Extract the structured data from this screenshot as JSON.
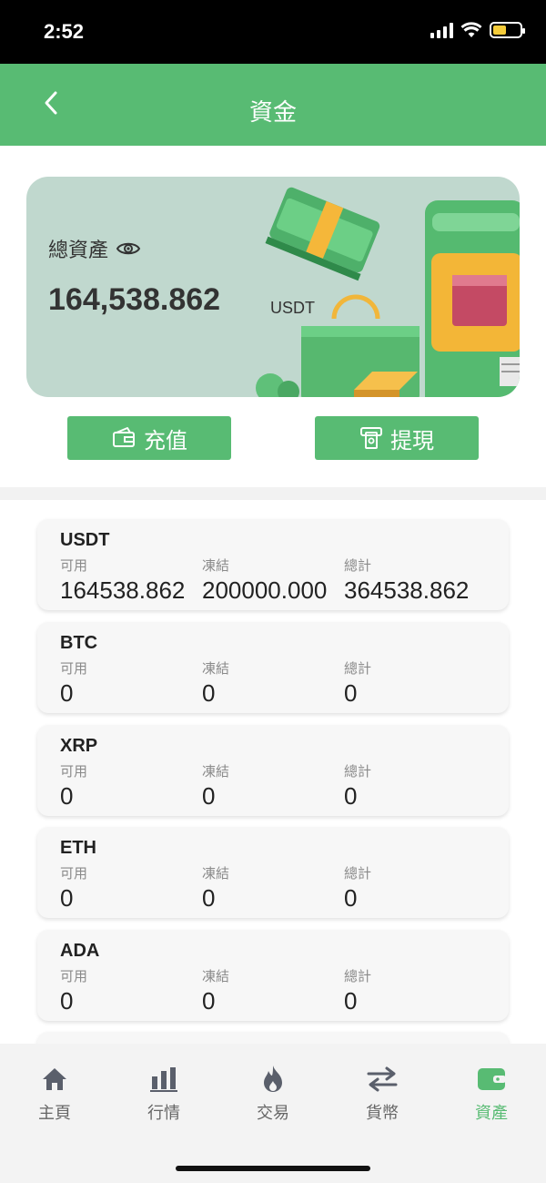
{
  "status_bar": {
    "time": "2:52"
  },
  "header": {
    "title": "資金"
  },
  "balance": {
    "label": "總資產",
    "value": "164,538.862",
    "unit": "USDT"
  },
  "actions": {
    "deposit_label": "充值",
    "withdraw_label": "提現"
  },
  "columns": {
    "available": "可用",
    "frozen": "凍結",
    "total": "總計"
  },
  "assets": [
    {
      "symbol": "USDT",
      "available": "164538.862",
      "frozen": "200000.000",
      "total": "364538.862"
    },
    {
      "symbol": "BTC",
      "available": "0",
      "frozen": "0",
      "total": "0"
    },
    {
      "symbol": "XRP",
      "available": "0",
      "frozen": "0",
      "total": "0"
    },
    {
      "symbol": "ETH",
      "available": "0",
      "frozen": "0",
      "total": "0"
    },
    {
      "symbol": "ADA",
      "available": "0",
      "frozen": "0",
      "total": "0"
    }
  ],
  "tabs": [
    {
      "label": "主頁",
      "icon": "home-icon"
    },
    {
      "label": "行情",
      "icon": "bar-chart-icon"
    },
    {
      "label": "交易",
      "icon": "flame-icon"
    },
    {
      "label": "貨幣",
      "icon": "swap-arrows-icon"
    },
    {
      "label": "資產",
      "icon": "wallet-icon",
      "active": true
    }
  ],
  "colors": {
    "brand": "#58bb73",
    "card_bg": "#c0d8ce",
    "tab_inactive": "#666666"
  }
}
